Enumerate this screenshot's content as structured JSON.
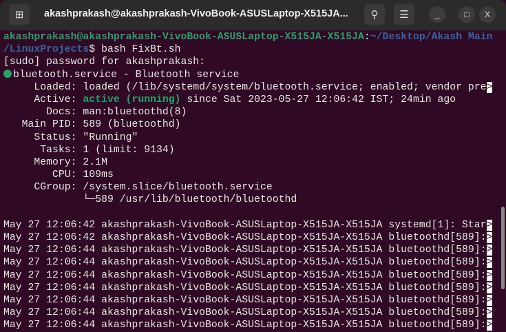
{
  "window": {
    "title": "akashprakash@akashprakash-VivoBook-ASUSLaptop-X515JA...",
    "new_tab_icon": "new-tab-icon",
    "search_icon": "search-icon",
    "menu_icon": "hamburger-menu-icon",
    "minimize": "_",
    "maximize": "□",
    "close": "X"
  },
  "terminal": {
    "prompt_user": "akashprakash@akashprakash-VivoBook-ASUSLaptop-X515JA-X515JA",
    "prompt_colon": ":",
    "prompt_path1": "~/Desktop/Akash Main",
    "prompt_path2": "/LinuxProjects",
    "prompt_cmd": "$ bash FixBt.sh",
    "sudo": "[sudo] password for akashprakash:",
    "service_header": "bluetooth.service - Bluetooth service",
    "loaded": "     Loaded: loaded (/lib/systemd/system/bluetooth.service; enabled; vendor pre",
    "active_label": "     Active: ",
    "active_state": "active (running)",
    "active_rest": " since Sat 2023-05-27 12:06:42 IST; 24min ago",
    "docs": "       Docs: man:bluetoothd(8)",
    "pid": "   Main PID: 589 (bluetoothd)",
    "status": "     Status: \"Running\"",
    "tasks": "      Tasks: 1 (limit: 9134)",
    "memory": "     Memory: 2.1M",
    "cpu": "        CPU: 109ms",
    "cgroup": "     CGroup: /system.slice/bluetooth.service",
    "cgroup_child": "             └─589 /usr/lib/bluetooth/bluetoothd",
    "log_lines": [
      "May 27 12:06:42 akashprakash-VivoBook-ASUSLaptop-X515JA-X515JA systemd[1]: Star",
      "May 27 12:06:42 akashprakash-VivoBook-ASUSLaptop-X515JA-X515JA bluetoothd[589]:",
      "May 27 12:06:44 akashprakash-VivoBook-ASUSLaptop-X515JA-X515JA bluetoothd[589]:",
      "May 27 12:06:44 akashprakash-VivoBook-ASUSLaptop-X515JA-X515JA bluetoothd[589]:",
      "May 27 12:06:44 akashprakash-VivoBook-ASUSLaptop-X515JA-X515JA bluetoothd[589]:",
      "May 27 12:06:44 akashprakash-VivoBook-ASUSLaptop-X515JA-X515JA bluetoothd[589]:",
      "May 27 12:06:44 akashprakash-VivoBook-ASUSLaptop-X515JA-X515JA bluetoothd[589]:",
      "May 27 12:06:44 akashprakash-VivoBook-ASUSLaptop-X515JA-X515JA bluetoothd[589]:",
      "May 27 12:06:44 akashprakash-VivoBook-ASUSLaptop-X515JA-X515JA bluetoothd[589]:"
    ],
    "overflow_marker": ">"
  }
}
